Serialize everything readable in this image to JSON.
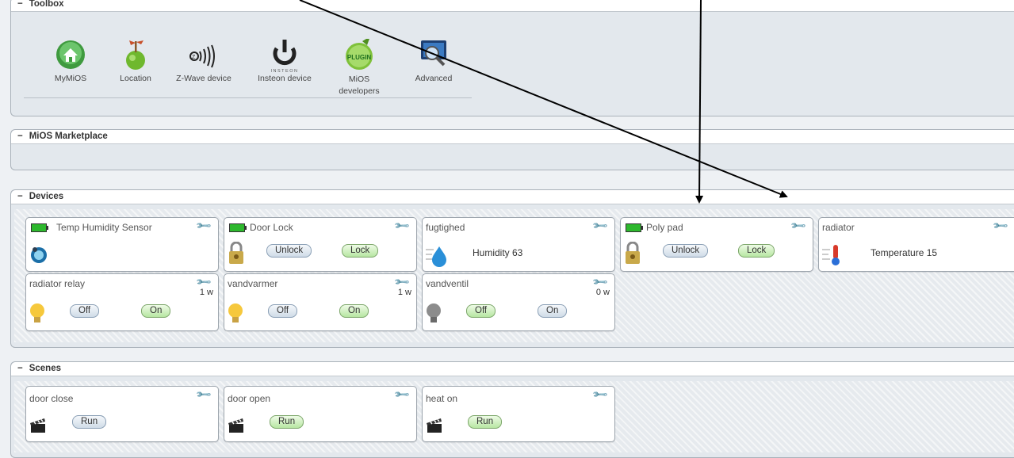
{
  "toolbox": {
    "title": "Toolbox",
    "toggle": "−",
    "items": [
      {
        "label": "MyMiOS",
        "icon": "house-icon"
      },
      {
        "label": "Location",
        "icon": "location-globe-icon"
      },
      {
        "label": "Z-Wave device",
        "icon": "zwave-icon"
      },
      {
        "label": "Insteon device",
        "icon": "insteon-power-icon"
      },
      {
        "label": "MiOS developers",
        "icon": "plugin-icon"
      },
      {
        "label": "Advanced",
        "icon": "monitor-magnifier-icon"
      }
    ],
    "insteon_text": "INSTEON",
    "plugin_text": "PLUGIN"
  },
  "marketplace": {
    "title": "MiOS Marketplace",
    "toggle": "−"
  },
  "devices": {
    "title": "Devices",
    "toggle": "−",
    "cards": [
      {
        "name": "Temp Humidity Sensor",
        "battery": true,
        "icon": "sensor-icon"
      },
      {
        "name": "Door Lock",
        "battery": true,
        "icon": "padlock-icon",
        "buttons": [
          "Unlock",
          "Lock"
        ]
      },
      {
        "name": "fugtighed",
        "icon": "water-drop-icon",
        "value": "Humidity 63"
      },
      {
        "name": "Poly pad",
        "battery": true,
        "icon": "padlock-icon",
        "buttons": [
          "Unlock",
          "Lock"
        ]
      },
      {
        "name": "radiator",
        "icon": "thermometer-icon",
        "value": "Temperature 15"
      },
      {
        "name": "radiator relay",
        "icon": "light-bulb-on-icon",
        "watt": "1 w",
        "buttons": [
          "Off",
          "On"
        ]
      },
      {
        "name": "vandvarmer",
        "icon": "light-bulb-on-icon",
        "watt": "1 w",
        "buttons": [
          "Off",
          "On"
        ]
      },
      {
        "name": "vandventil",
        "icon": "light-bulb-off-icon",
        "watt": "0 w",
        "buttons": [
          "Off",
          "On"
        ]
      }
    ]
  },
  "scenes": {
    "title": "Scenes",
    "toggle": "−",
    "cards": [
      {
        "name": "door close",
        "button": "Run"
      },
      {
        "name": "door open",
        "button": "Run"
      },
      {
        "name": "heat on",
        "button": "Run"
      }
    ]
  },
  "colors": {
    "battery": "#2db82d",
    "green_button": "#b7e6a2",
    "blue_button": "#cfdbe7"
  }
}
